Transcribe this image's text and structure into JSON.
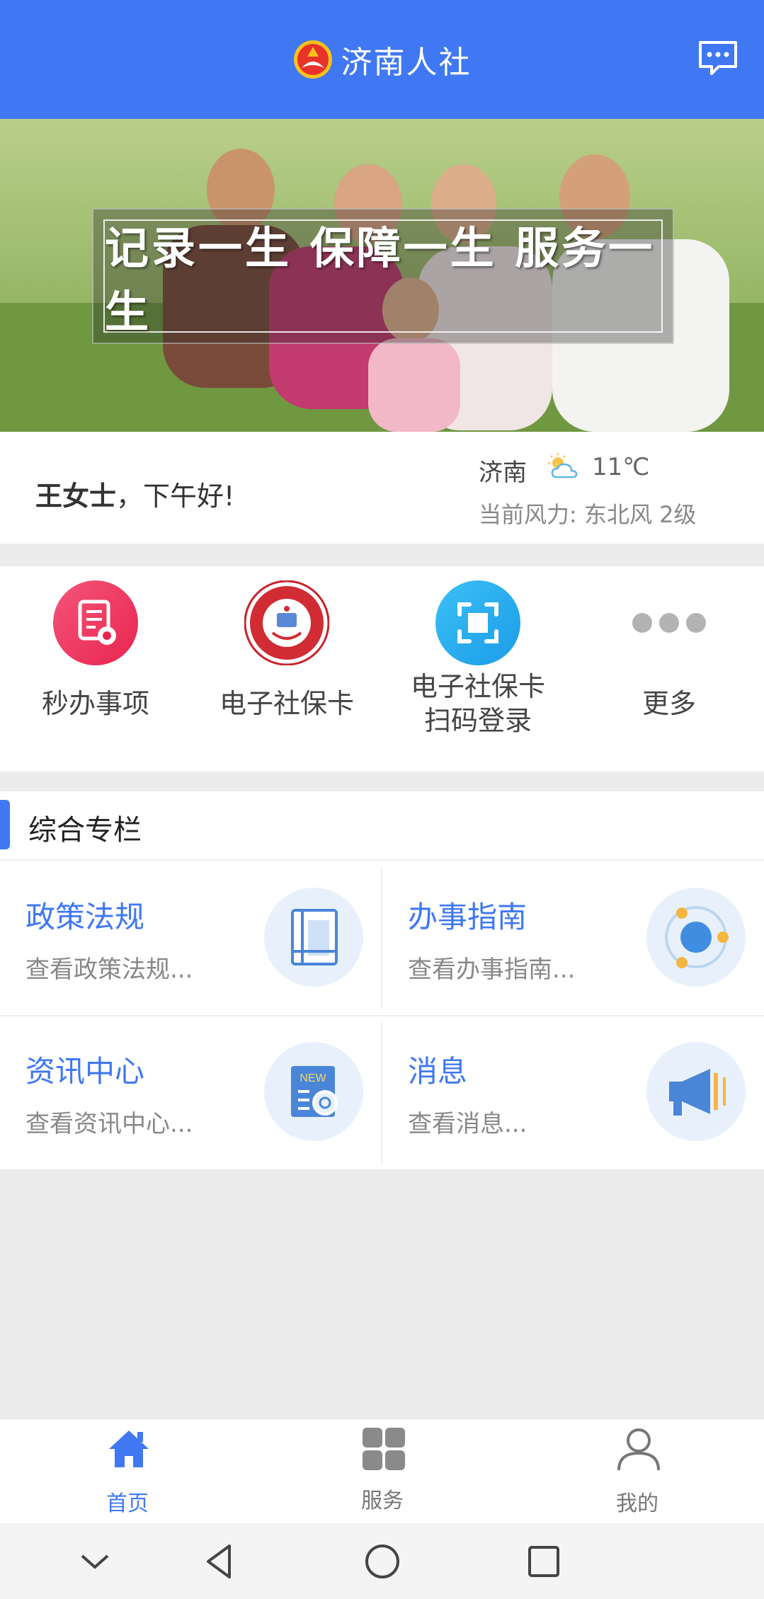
{
  "header": {
    "title": "济南人社",
    "logo_icon": "jinan-hrss-logo-icon",
    "message_icon": "chat-message-icon",
    "color": "#3f78f2"
  },
  "banner": {
    "slogan": "记录一生 保障一生 服务一生"
  },
  "greeting": {
    "name": "王女士",
    "text": "，下午好!",
    "city": "济南",
    "weather_icon": "partly-cloudy-icon",
    "temperature": "11℃",
    "wind": "当前风力: 东北风 2级"
  },
  "quick_actions": [
    {
      "label": "秒办事项",
      "icon": "document-badge-icon"
    },
    {
      "label": "电子社保卡",
      "icon": "social-security-card-icon"
    },
    {
      "label_line1": "电子社保卡",
      "label_line2": "扫码登录",
      "icon": "scan-icon"
    },
    {
      "label": "更多",
      "icon": "more-dots-icon"
    }
  ],
  "section": {
    "title": "综合专栏",
    "cards": [
      {
        "title": "政策法规",
        "subtitle": "查看政策法规...",
        "icon": "book-icon"
      },
      {
        "title": "办事指南",
        "subtitle": "查看办事指南...",
        "icon": "orbit-icon"
      },
      {
        "title": "资讯中心",
        "subtitle": "查看资讯中心...",
        "icon": "news-icon"
      },
      {
        "title": "消息",
        "subtitle": "查看消息...",
        "icon": "megaphone-icon"
      }
    ]
  },
  "tabbar": {
    "tabs": [
      {
        "label": "首页",
        "icon": "home-icon",
        "active": true
      },
      {
        "label": "服务",
        "icon": "grid-icon",
        "active": false
      },
      {
        "label": "我的",
        "icon": "user-icon",
        "active": false
      }
    ],
    "active_color": "#3f78f2"
  }
}
